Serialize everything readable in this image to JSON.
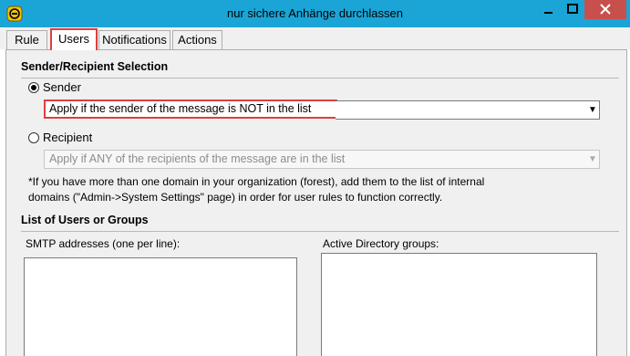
{
  "window": {
    "title": "nur sichere Anhänge durchlassen",
    "icon": "app-yellow-badge-icon",
    "controls": {
      "minimize": "window-minimize-icon",
      "maximize": "window-maximize-icon",
      "close": "window-close-icon"
    },
    "colors": {
      "titlebar": "#1aa5d6",
      "close": "#c7504c",
      "highlight": "#e03e3e"
    }
  },
  "tabs": [
    {
      "label": "Rule"
    },
    {
      "label": "Users",
      "active": true
    },
    {
      "label": "Notifications"
    },
    {
      "label": "Actions"
    }
  ],
  "selection": {
    "title": "Sender/Recipient Selection",
    "sender": {
      "label": "Sender",
      "checked": true,
      "dropdown_value": "Apply if the sender of the message is NOT in the list"
    },
    "recipient": {
      "label": "Recipient",
      "checked": false,
      "dropdown_value": "Apply if ANY of the recipients of the message are in the list"
    },
    "note_line1": "*If you have more than one domain in your organization (forest), add them to the list of internal",
    "note_line2": "domains (\"Admin->System Settings\" page) in order for user rules to function correctly."
  },
  "users": {
    "title": "List of Users or Groups",
    "smtp_label": "SMTP addresses (one per line):",
    "smtp_value": "",
    "ad_label": "Active Directory groups:",
    "ad_value": ""
  }
}
